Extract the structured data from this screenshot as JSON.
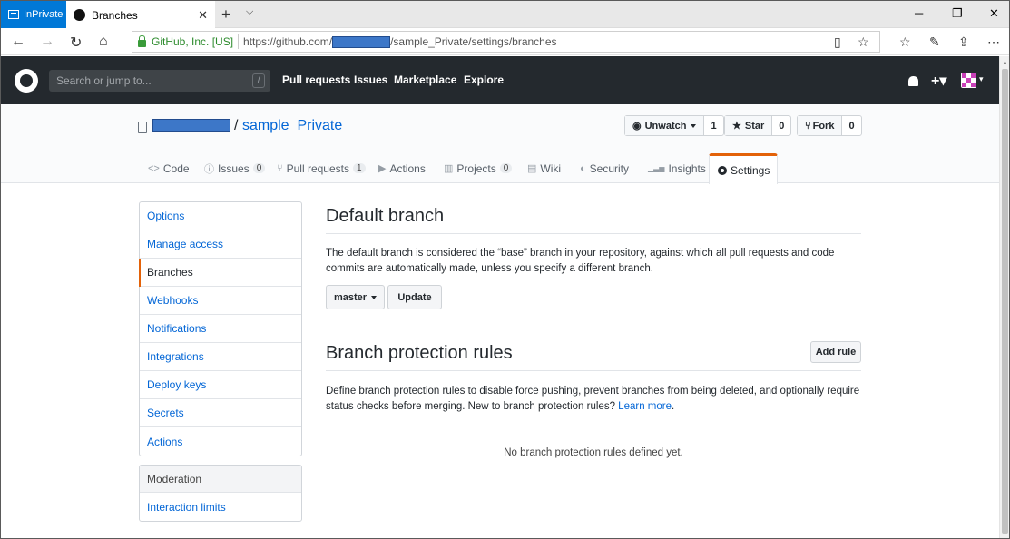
{
  "browser": {
    "inprivate_label": "InPrivate",
    "tab_title": "Branches",
    "tab_close": "✕",
    "new_tab": "+",
    "tab_menu": "⌵",
    "window_controls": {
      "minimize": "─",
      "maximize": "❐",
      "close": "✕"
    },
    "nav": {
      "back": "←",
      "forward": "→",
      "refresh": "↻",
      "home": "⌂"
    },
    "cert_label": "GitHub, Inc. [US]",
    "url_prefix": "https://github.com/",
    "url_host": "github.com",
    "url_suffix": "/sample_Private/settings/branches",
    "tools": {
      "reading_view": "▯",
      "favorite": "☆",
      "hub": "☆",
      "notes": "✎",
      "share": "⇪",
      "more": "⋯"
    }
  },
  "github_header": {
    "search_placeholder": "Search or jump to...",
    "search_shortcut": "/",
    "nav": [
      "Pull requests",
      "Issues",
      "Marketplace",
      "Explore"
    ],
    "plus_menu": "+▾",
    "avatar_caret": "▾"
  },
  "repo": {
    "separator": "/",
    "name": "sample_Private",
    "actions": {
      "watch": {
        "label": "Unwatch",
        "count": "1"
      },
      "star": {
        "label": "Star",
        "count": "0"
      },
      "fork": {
        "label": "Fork",
        "count": "0"
      }
    },
    "tabs": [
      {
        "label": "Code",
        "icon": "<>",
        "count": ""
      },
      {
        "label": "Issues",
        "icon": "ⓘ",
        "count": "0"
      },
      {
        "label": "Pull requests",
        "icon": "⑂",
        "count": "1"
      },
      {
        "label": "Actions",
        "icon": "▶",
        "count": ""
      },
      {
        "label": "Projects",
        "icon": "▥",
        "count": "0"
      },
      {
        "label": "Wiki",
        "icon": "▤",
        "count": ""
      },
      {
        "label": "Security",
        "icon": "◐",
        "count": ""
      },
      {
        "label": "Insights",
        "icon": "▁▃▅",
        "count": ""
      },
      {
        "label": "Settings",
        "icon": "gear",
        "count": ""
      }
    ]
  },
  "sidebar": {
    "items": [
      "Options",
      "Manage access",
      "Branches",
      "Webhooks",
      "Notifications",
      "Integrations",
      "Deploy keys",
      "Secrets",
      "Actions"
    ],
    "selected": "Branches",
    "moderation_header": "Moderation",
    "moderation_items": [
      "Interaction limits"
    ]
  },
  "default_branch": {
    "title": "Default branch",
    "description": "The default branch is considered the “base” branch in your repository, against which all pull requests and code commits are automatically made, unless you specify a different branch.",
    "branch_button": "master",
    "update_button": "Update"
  },
  "protection": {
    "title": "Branch protection rules",
    "add_rule_button": "Add rule",
    "description": "Define branch protection rules to disable force pushing, prevent branches from being deleted, and optionally require status checks before merging. New to branch protection rules?",
    "learn_more": "Learn more",
    "period": ".",
    "empty_message": "No branch protection rules defined yet."
  },
  "colors": {
    "accent": "#e36209",
    "link": "#0366d6",
    "header_bg": "#24292e",
    "inprivate": "#0078d7"
  }
}
